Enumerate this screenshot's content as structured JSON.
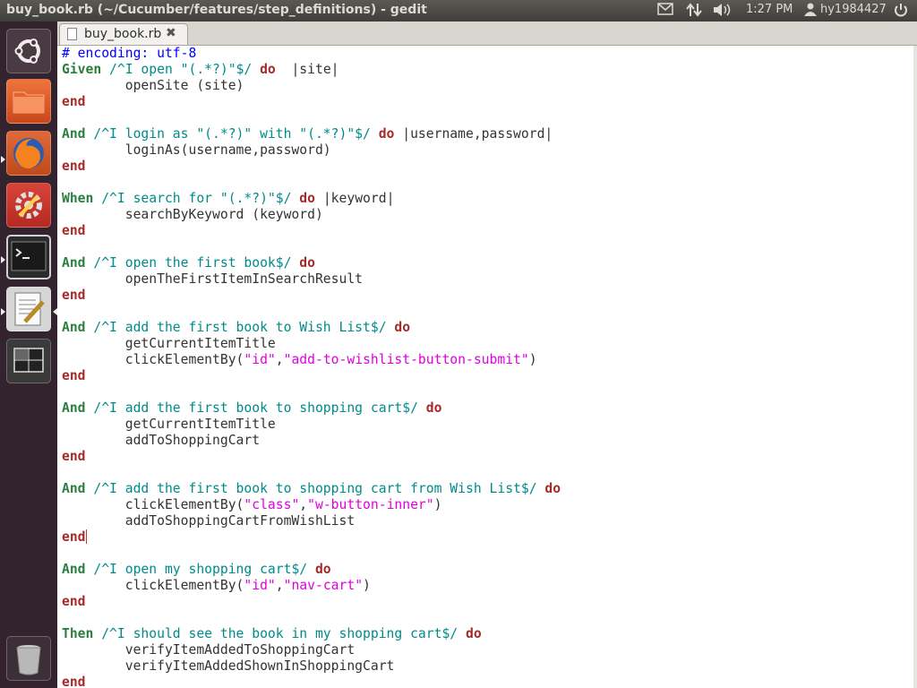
{
  "window": {
    "title": "buy_book.rb (~/Cucumber/features/step_definitions) - gedit"
  },
  "indicators": {
    "time": "1:27 PM",
    "user": "hy1984427"
  },
  "launcher": {
    "items": [
      {
        "name": "ubuntu-dash",
        "icon": "ubuntu-logo-icon"
      },
      {
        "name": "files",
        "icon": "folder-icon"
      },
      {
        "name": "firefox",
        "icon": "firefox-icon"
      },
      {
        "name": "system-settings",
        "icon": "settings-icon"
      },
      {
        "name": "terminal",
        "icon": "terminal-icon"
      },
      {
        "name": "gedit",
        "icon": "text-editor-icon"
      },
      {
        "name": "workspace-switcher",
        "icon": "workspace-icon"
      },
      {
        "name": "trash",
        "icon": "trash-icon"
      }
    ]
  },
  "tab": {
    "label": "buy_book.rb"
  },
  "code_lines": [
    [
      [
        "cm",
        "# encoding: utf-8"
      ]
    ],
    [
      [
        "kw",
        "Given"
      ],
      [
        "rx",
        " /^I open \"(.*?)\"$/ "
      ],
      [
        "kr",
        "do"
      ],
      [
        "",
        "  |site|"
      ]
    ],
    [
      [
        "",
        "        openSite (site)"
      ]
    ],
    [
      [
        "kr",
        "end"
      ]
    ],
    [],
    [
      [
        "kw",
        "And"
      ],
      [
        "rx",
        " /^I login as \"(.*?)\" with \"(.*?)\"$/ "
      ],
      [
        "kr",
        "do"
      ],
      [
        "",
        " |username,password|"
      ]
    ],
    [
      [
        "",
        "        loginAs(username,password)"
      ]
    ],
    [
      [
        "kr",
        "end"
      ]
    ],
    [],
    [
      [
        "kw",
        "When"
      ],
      [
        "rx",
        " /^I search for \"(.*?)\"$/ "
      ],
      [
        "kr",
        "do"
      ],
      [
        "",
        " |keyword|"
      ]
    ],
    [
      [
        "",
        "        searchByKeyword (keyword)"
      ]
    ],
    [
      [
        "kr",
        "end"
      ]
    ],
    [],
    [
      [
        "kw",
        "And"
      ],
      [
        "rx",
        " /^I open the first book$/ "
      ],
      [
        "kr",
        "do"
      ]
    ],
    [
      [
        "",
        "        openTheFirstItemInSearchResult"
      ]
    ],
    [
      [
        "kr",
        "end"
      ]
    ],
    [],
    [
      [
        "kw",
        "And"
      ],
      [
        "rx",
        " /^I add the first book to Wish List$/ "
      ],
      [
        "kr",
        "do"
      ]
    ],
    [
      [
        "",
        "        getCurrentItemTitle"
      ]
    ],
    [
      [
        "",
        "        clickElementBy("
      ],
      [
        "st",
        "\"id\""
      ],
      [
        "",
        ","
      ],
      [
        "st",
        "\"add-to-wishlist-button-submit\""
      ],
      [
        "",
        ")"
      ]
    ],
    [
      [
        "kr",
        "end"
      ]
    ],
    [],
    [
      [
        "kw",
        "And"
      ],
      [
        "rx",
        " /^I add the first book to shopping cart$/ "
      ],
      [
        "kr",
        "do"
      ]
    ],
    [
      [
        "",
        "        getCurrentItemTitle"
      ]
    ],
    [
      [
        "",
        "        addToShoppingCart"
      ]
    ],
    [
      [
        "kr",
        "end"
      ]
    ],
    [],
    [
      [
        "kw",
        "And"
      ],
      [
        "rx",
        " /^I add the first book to shopping cart from Wish List$/ "
      ],
      [
        "kr",
        "do"
      ]
    ],
    [
      [
        "",
        "        clickElementBy("
      ],
      [
        "st",
        "\"class\""
      ],
      [
        "",
        ","
      ],
      [
        "st",
        "\"w-button-inner\""
      ],
      [
        "",
        ")"
      ]
    ],
    [
      [
        "",
        "        addToShoppingCartFromWishList"
      ]
    ],
    [
      [
        "kr",
        "end"
      ]
    ],
    [],
    [
      [
        "kw",
        "And"
      ],
      [
        "rx",
        " /^I open my shopping cart$/ "
      ],
      [
        "kr",
        "do"
      ]
    ],
    [
      [
        "",
        "        clickElementBy("
      ],
      [
        "st",
        "\"id\""
      ],
      [
        "",
        ","
      ],
      [
        "st",
        "\"nav-cart\""
      ],
      [
        "",
        ")"
      ]
    ],
    [
      [
        "kr",
        "end"
      ]
    ],
    [],
    [
      [
        "kw",
        "Then"
      ],
      [
        "rx",
        " /^I should see the book in my shopping cart$/ "
      ],
      [
        "kr",
        "do"
      ]
    ],
    [
      [
        "",
        "        verifyItemAddedToShoppingCart"
      ]
    ],
    [
      [
        "",
        "        verifyItemAddedShownInShoppingCart"
      ]
    ],
    [
      [
        "kr",
        "end"
      ]
    ]
  ]
}
